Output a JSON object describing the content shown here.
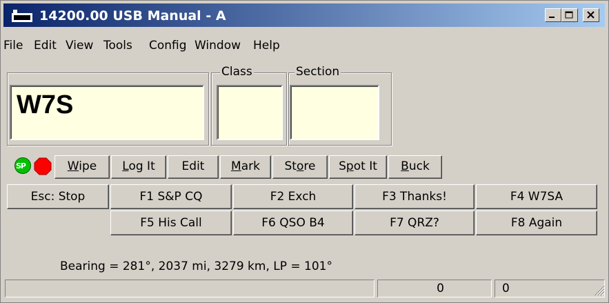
{
  "window": {
    "title": "14200.00 USB Manual - A"
  },
  "menu": [
    "File",
    "Edit",
    "View",
    "Tools",
    "Config",
    "Window",
    "Help"
  ],
  "entry": {
    "call_value": "W7S",
    "class_label": "Class",
    "section_label": "Section",
    "class_value": "",
    "section_value": ""
  },
  "indicators": {
    "sp_label": "SP",
    "sp_color": "#00c000",
    "stop_color": "#ff0000"
  },
  "buttons": {
    "wipe": {
      "pre": "",
      "u": "W",
      "post": "ipe"
    },
    "logit": {
      "pre": "",
      "u": "L",
      "post": "og It"
    },
    "edit": {
      "pre": "",
      "u": "E",
      "post": "dit"
    },
    "mark": {
      "pre": "",
      "u": "M",
      "post": "ark"
    },
    "store": {
      "pre": "St",
      "u": "o",
      "post": "re"
    },
    "spotit": {
      "pre": "S",
      "u": "p",
      "post": "ot It"
    },
    "buck": {
      "pre": "",
      "u": "B",
      "post": "uck"
    }
  },
  "function_keys": {
    "esc": "Esc: Stop",
    "f1": "F1 S&P CQ",
    "f2": "F2 Exch",
    "f3": "F3 Thanks!",
    "f4": "F4 W7SA",
    "f5": "F5 His Call",
    "f6": "F6 QSO B4",
    "f7": "F7 QRZ?",
    "f8": "F8 Again"
  },
  "bearing_text": "Bearing = 281°, 2037  mi, 3279 km, LP = 101°",
  "statusbar": {
    "cell1": "",
    "cell2": "0",
    "cell3": "0"
  }
}
